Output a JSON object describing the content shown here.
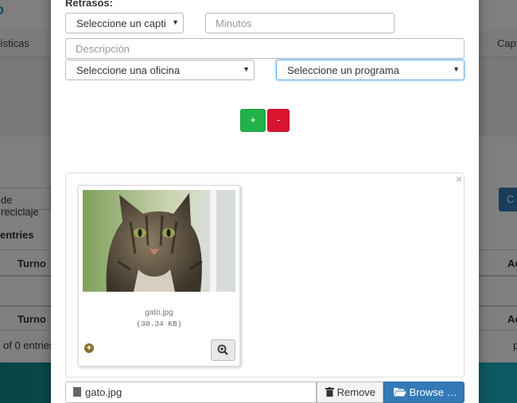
{
  "background": {
    "logo": "o",
    "nav_left": "ísticas",
    "nav_right": "Capt",
    "reciclaje": "de reciclaje",
    "right_button": "C",
    "entries_label": "entries",
    "col_turno": "Turno",
    "col_ac": "Ac",
    "info_text": "of 0 entries",
    "page_letter": "p"
  },
  "modal": {
    "section_label": "Retrasos:",
    "capitulo_select": "Seleccione un capti",
    "minutos_placeholder": "Minutos",
    "descripcion_placeholder": "Descripción",
    "oficina_select": "Seleccione una oficina",
    "programa_select": "Seleccione un programa",
    "add_label": "+",
    "remove_row_label": "-",
    "close_label": "×",
    "file": {
      "name": "gato.jpg",
      "size": "(30.34 KB)"
    },
    "caption_filename": "gato.jpg",
    "remove_label": "Remove",
    "browse_label": "Browse …"
  },
  "colors": {
    "add_button": "#22b24c",
    "remove_row_button": "#d9142e",
    "browse_button": "#337ab7"
  }
}
